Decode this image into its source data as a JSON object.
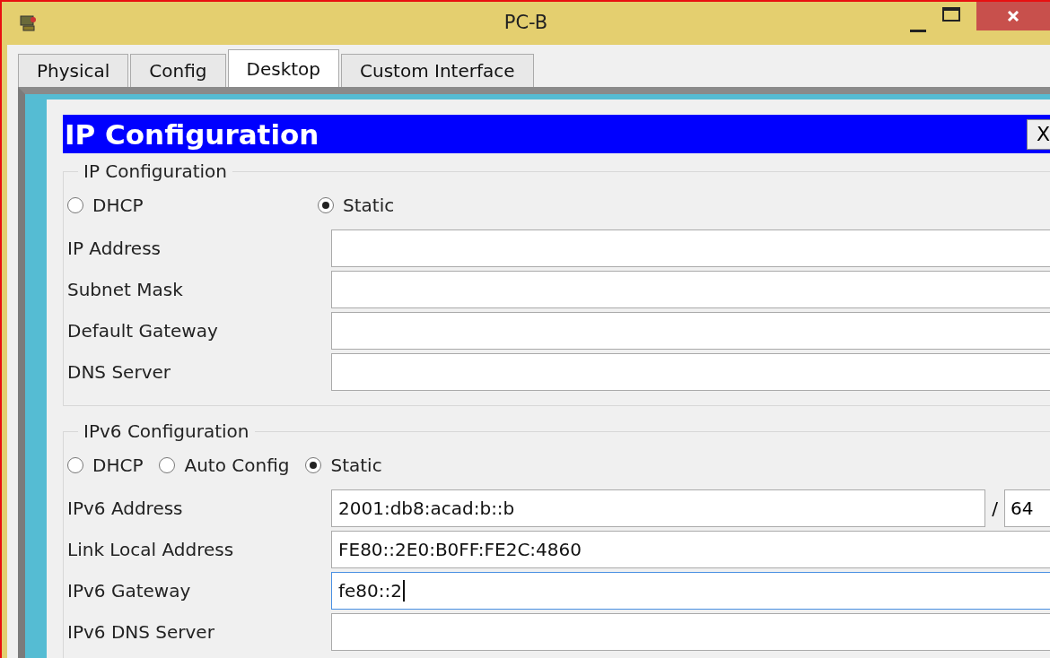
{
  "window": {
    "title": "PC-B"
  },
  "tabs": [
    {
      "label": "Physical",
      "selected": false
    },
    {
      "label": "Config",
      "selected": false
    },
    {
      "label": "Desktop",
      "selected": true
    },
    {
      "label": "Custom Interface",
      "selected": false
    }
  ],
  "dialog": {
    "title": "IP Configuration",
    "close": "X",
    "ipv4": {
      "legend": "IP Configuration",
      "modes": [
        {
          "label": "DHCP",
          "selected": false
        },
        {
          "label": "Static",
          "selected": true
        }
      ],
      "fields": [
        {
          "label": "IP Address"
        },
        {
          "label": "Subnet Mask"
        },
        {
          "label": "Default Gateway"
        },
        {
          "label": "DNS Server"
        }
      ]
    },
    "ipv6": {
      "legend": "IPv6 Configuration",
      "modes": [
        {
          "label": "DHCP",
          "selected": false
        },
        {
          "label": "Auto Config",
          "selected": false
        },
        {
          "label": "Static",
          "selected": true
        }
      ],
      "fields": [
        {
          "label": "IPv6 Address",
          "value": "2001:db8:acad:b::b",
          "separator": "/",
          "prefix": "64",
          "focused": false
        },
        {
          "label": "Link Local Address",
          "value": "FE80::2E0:B0FF:FE2C:4860",
          "focused": false
        },
        {
          "label": "IPv6 Gateway",
          "value": "fe80::2",
          "focused": true
        },
        {
          "label": "IPv6 DNS Server",
          "focused": false
        }
      ]
    }
  }
}
